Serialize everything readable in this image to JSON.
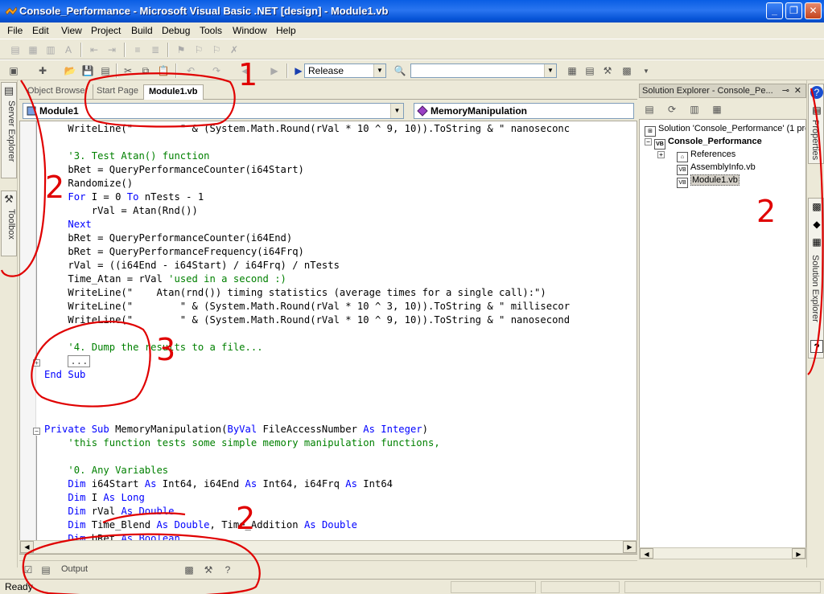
{
  "window": {
    "title": "Console_Performance - Microsoft Visual Basic .NET [design] - Module1.vb",
    "minimize_glyph": "_",
    "restore_glyph": "❐",
    "close_glyph": "✕"
  },
  "menu": {
    "items": [
      "File",
      "Edit",
      "View",
      "Project",
      "Build",
      "Debug",
      "Tools",
      "Window",
      "Help"
    ]
  },
  "toolbar": {
    "configuration": "Release",
    "find_combo": ""
  },
  "left_strip": {
    "server_explorer": "Server Explorer",
    "toolbox": "Toolbox"
  },
  "doc_tabs": {
    "items": [
      "Object Browser",
      "Start Page",
      "Module1.vb"
    ],
    "active": "Module1.vb"
  },
  "nav": {
    "class_combo": "Module1",
    "method_combo": "MemoryManipulation"
  },
  "code_lines": [
    [
      {
        "t": "WriteLine(\"        \" & (System.Math.Round(rVal * 10 ^ 9, 10)).ToString & \" nanoseconc",
        "c": ""
      }
    ],
    [
      {
        "t": "",
        "c": ""
      }
    ],
    [
      {
        "t": "'3. Test Atan() function",
        "c": "cm"
      }
    ],
    [
      {
        "t": "bRet = QueryPerformanceCounter(i64Start)",
        "c": ""
      }
    ],
    [
      {
        "t": "Randomize()",
        "c": ""
      }
    ],
    [
      {
        "t": "For",
        "c": "kw"
      },
      {
        "t": " I = 0 ",
        "c": ""
      },
      {
        "t": "To",
        "c": "kw"
      },
      {
        "t": " nTests - 1",
        "c": ""
      }
    ],
    [
      {
        "t": "    rVal = Atan(Rnd())",
        "c": ""
      }
    ],
    [
      {
        "t": "Next",
        "c": "kw"
      }
    ],
    [
      {
        "t": "bRet = QueryPerformanceCounter(i64End)",
        "c": ""
      }
    ],
    [
      {
        "t": "bRet = QueryPerformanceFrequency(i64Frq)",
        "c": ""
      }
    ],
    [
      {
        "t": "rVal = ((i64End - i64Start) / i64Frq) / nTests",
        "c": ""
      }
    ],
    [
      {
        "t": "Time_Atan = rVal ",
        "c": ""
      },
      {
        "t": "'used in a second :)",
        "c": "cm"
      }
    ],
    [
      {
        "t": "WriteLine(\"    Atan(rnd()) timing statistics (average times for a single call):\")",
        "c": ""
      }
    ],
    [
      {
        "t": "WriteLine(\"        \" & (System.Math.Round(rVal * 10 ^ 3, 10)).ToString & \" millisecor",
        "c": ""
      }
    ],
    [
      {
        "t": "WriteLine(\"        \" & (System.Math.Round(rVal * 10 ^ 9, 10)).ToString & \" nanosecond",
        "c": ""
      }
    ],
    [
      {
        "t": "",
        "c": ""
      }
    ],
    [
      {
        "t": "'4. Dump the results to a file...",
        "c": "cm"
      }
    ],
    [
      {
        "t": "...",
        "c": "box"
      }
    ],
    [
      {
        "t": "End",
        "c": "kw"
      },
      {
        "t": " ",
        "c": ""
      },
      {
        "t": "Sub",
        "c": "kw"
      }
    ],
    [
      {
        "t": "",
        "c": ""
      }
    ],
    [
      {
        "t": "",
        "c": ""
      }
    ],
    [
      {
        "t": "",
        "c": ""
      }
    ],
    [
      {
        "t": "Private",
        "c": "kw"
      },
      {
        "t": " ",
        "c": ""
      },
      {
        "t": "Sub",
        "c": "kw"
      },
      {
        "t": " MemoryManipulation(",
        "c": ""
      },
      {
        "t": "ByVal",
        "c": "kw"
      },
      {
        "t": " FileAccessNumber ",
        "c": ""
      },
      {
        "t": "As",
        "c": "kw"
      },
      {
        "t": " ",
        "c": ""
      },
      {
        "t": "Integer",
        "c": "kw"
      },
      {
        "t": ")",
        "c": ""
      }
    ],
    [
      {
        "t": "'this function tests some simple memory manipulation functions,",
        "c": "cm"
      }
    ],
    [
      {
        "t": "",
        "c": ""
      }
    ],
    [
      {
        "t": "'0. Any Variables",
        "c": "cm"
      }
    ],
    [
      {
        "t": "Dim",
        "c": "kw"
      },
      {
        "t": " i64Start ",
        "c": ""
      },
      {
        "t": "As",
        "c": "kw"
      },
      {
        "t": " Int64, i64End ",
        "c": ""
      },
      {
        "t": "As",
        "c": "kw"
      },
      {
        "t": " Int64, i64Frq ",
        "c": ""
      },
      {
        "t": "As",
        "c": "kw"
      },
      {
        "t": " Int64",
        "c": ""
      }
    ],
    [
      {
        "t": "Dim",
        "c": "kw"
      },
      {
        "t": " I ",
        "c": ""
      },
      {
        "t": "As",
        "c": "kw"
      },
      {
        "t": " ",
        "c": ""
      },
      {
        "t": "Long",
        "c": "kw"
      }
    ],
    [
      {
        "t": "Dim",
        "c": "kw"
      },
      {
        "t": " rVal ",
        "c": ""
      },
      {
        "t": "As",
        "c": "kw"
      },
      {
        "t": " ",
        "c": ""
      },
      {
        "t": "Double",
        "c": "kw"
      }
    ],
    [
      {
        "t": "Dim",
        "c": "kw"
      },
      {
        "t": " Time_Blend ",
        "c": ""
      },
      {
        "t": "As",
        "c": "kw"
      },
      {
        "t": " ",
        "c": ""
      },
      {
        "t": "Double",
        "c": "kw"
      },
      {
        "t": ", Time_Addition ",
        "c": ""
      },
      {
        "t": "As",
        "c": "kw"
      },
      {
        "t": " ",
        "c": ""
      },
      {
        "t": "Double",
        "c": "kw"
      }
    ],
    [
      {
        "t": "Dim",
        "c": "kw"
      },
      {
        "t": " bRet ",
        "c": ""
      },
      {
        "t": "As",
        "c": "kw"
      },
      {
        "t": " ",
        "c": ""
      },
      {
        "t": "Boolean",
        "c": "kw"
      }
    ]
  ],
  "solution_explorer": {
    "title": "Solution Explorer - Console_Pe...",
    "pin_glyph": "⊸",
    "close_glyph": "✕",
    "solution": "Solution 'Console_Performance' (1 pro",
    "project": "Console_Performance",
    "items": [
      "References",
      "AssemblyInfo.vb",
      "Module1.vb"
    ]
  },
  "right_strip": {
    "properties": "Properties",
    "solution_explorer": "Solution Explorer",
    "help_glyph": "?"
  },
  "output": {
    "label": "Output"
  },
  "status": {
    "text": "Ready"
  },
  "annotations": [
    "1",
    "2",
    "2",
    "2",
    "3"
  ]
}
